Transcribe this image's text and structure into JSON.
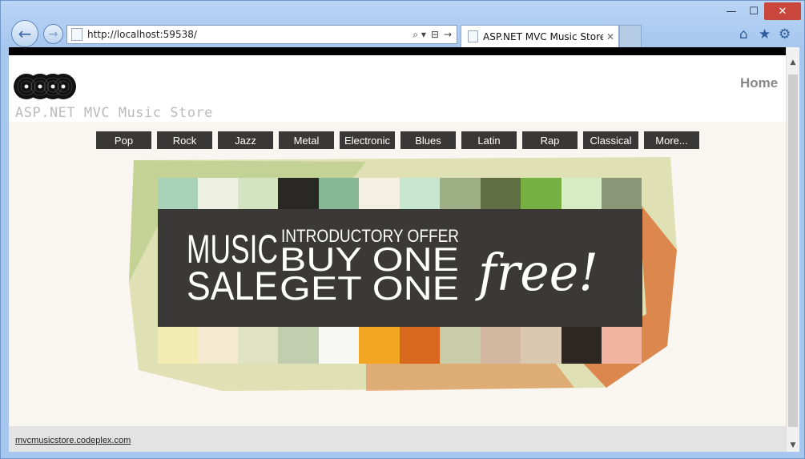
{
  "browser": {
    "window_controls": {
      "minimize": "—",
      "maximize": "☐",
      "close": "✕"
    },
    "back_icon": "arrow-left-icon",
    "forward_icon": "arrow-right-icon",
    "address": "http://localhost:59538/",
    "address_tools": {
      "search": "⌕ ▾",
      "compat": "⊟",
      "refresh": "→"
    },
    "tab": {
      "title": "ASP.NET MVC Music Store ...",
      "close": "✕"
    },
    "toolbar_icons": {
      "home": "⌂",
      "favorites": "★",
      "settings": "⚙"
    }
  },
  "site": {
    "title": "ASP.NET MVC Music Store",
    "nav": {
      "home": "Home"
    },
    "genres": [
      "Pop",
      "Rock",
      "Jazz",
      "Metal",
      "Electronic",
      "Blues",
      "Latin",
      "Rap",
      "Classical",
      "More..."
    ],
    "banner": {
      "line1_left": "MUSIC",
      "line2_left": "SALE",
      "line1_right": "INTRODUCTORY OFFER",
      "line2_right": "BUY ONE",
      "line3_right": "GET ONE",
      "script": "free!"
    },
    "footer_link": "mvcmusicstore.codeplex.com"
  },
  "colors": {
    "chrome_blue": "#a7c7ef",
    "close_red": "#c9463d",
    "genre_bg": "#3a3836",
    "banner_dark": "#3a3937"
  }
}
